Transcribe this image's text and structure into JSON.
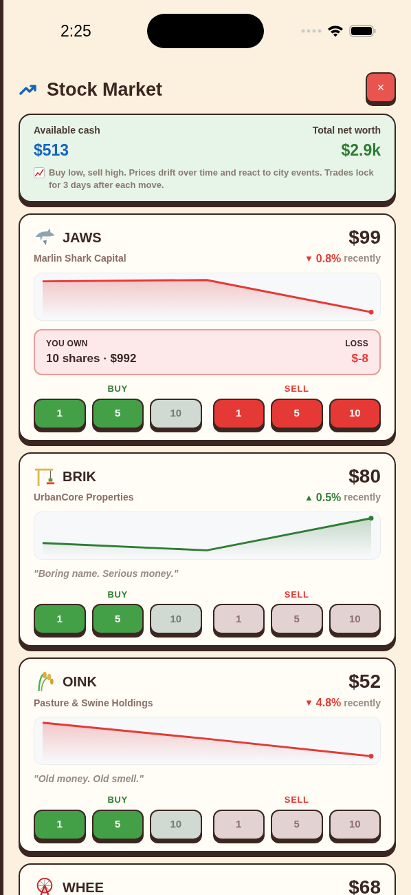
{
  "status_bar": {
    "time": "2:25"
  },
  "header": {
    "title": "Stock Market",
    "close": "×"
  },
  "summary": {
    "cash_label": "Available cash",
    "cash": "$513",
    "worth_label": "Total net worth",
    "worth": "$2.9k",
    "note": "Buy low, sell high. Prices drift over time and react to city events. Trades lock for 3 days after each move."
  },
  "stocks": [
    {
      "ticker": "JAWS",
      "company": "Marlin Shark Capital",
      "price": "$99",
      "arrow": "▼",
      "color": "#e53935",
      "change": "0.8%",
      "change_note": "recently",
      "holding": {
        "label": "YOU OWN",
        "value": "10 shares · $992",
        "result_label": "LOSS",
        "result": "$-8"
      },
      "buy_label": "BUY",
      "sell_label": "SELL",
      "buy": [
        {
          "label": "1",
          "disabled": false
        },
        {
          "label": "5",
          "disabled": false
        },
        {
          "label": "10",
          "disabled": true
        }
      ],
      "sell": [
        {
          "label": "1",
          "disabled": false
        },
        {
          "label": "5",
          "disabled": false
        },
        {
          "label": "10",
          "disabled": false
        }
      ]
    },
    {
      "ticker": "BRIK",
      "company": "UrbanCore Properties",
      "price": "$80",
      "arrow": "▲",
      "color": "#2e7d32",
      "change": "0.5%",
      "change_note": "recently",
      "tagline": "\"Boring name. Serious money.\"",
      "buy_label": "BUY",
      "sell_label": "SELL",
      "buy": [
        {
          "label": "1",
          "disabled": false
        },
        {
          "label": "5",
          "disabled": false
        },
        {
          "label": "10",
          "disabled": true
        }
      ],
      "sell": [
        {
          "label": "1",
          "disabled": true
        },
        {
          "label": "5",
          "disabled": true
        },
        {
          "label": "10",
          "disabled": true
        }
      ]
    },
    {
      "ticker": "OINK",
      "company": "Pasture & Swine Holdings",
      "price": "$52",
      "arrow": "▼",
      "color": "#e53935",
      "change": "4.8%",
      "change_note": "recently",
      "tagline": "\"Old money. Old smell.\"",
      "buy_label": "BUY",
      "sell_label": "SELL",
      "buy": [
        {
          "label": "1",
          "disabled": false
        },
        {
          "label": "5",
          "disabled": false
        },
        {
          "label": "10",
          "disabled": true
        }
      ],
      "sell": [
        {
          "label": "1",
          "disabled": true
        },
        {
          "label": "5",
          "disabled": true
        },
        {
          "label": "10",
          "disabled": true
        }
      ]
    },
    {
      "ticker": "WHEE",
      "price": "$68"
    }
  ]
}
